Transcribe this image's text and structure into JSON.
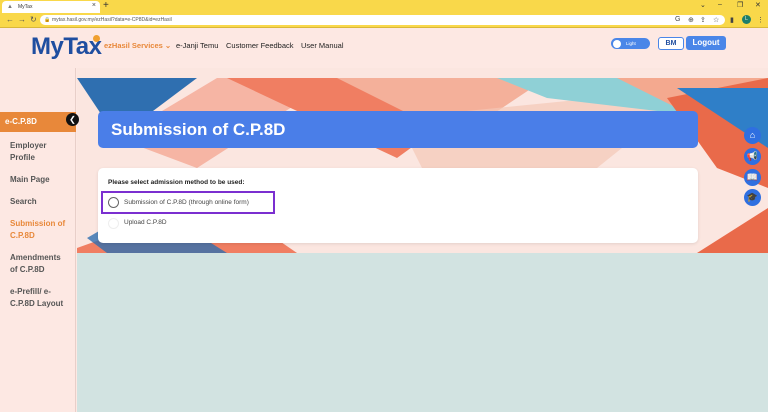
{
  "browser": {
    "tab_title": "MyTax",
    "url": "mytax.hasil.gov.my/ezHasil?data=e-CP8D&id=ezHasil"
  },
  "header": {
    "logo": "MyTax",
    "menu": [
      "ezHasil Services",
      "e-Janji Temu",
      "Customer Feedback",
      "User Manual"
    ],
    "toggle_label": "Light",
    "lang_button": "BM",
    "logout_button": "Logout"
  },
  "sidebar": {
    "title": "e-C.P.8D",
    "items": [
      {
        "label": "Employer Profile"
      },
      {
        "label": "Main Page"
      },
      {
        "label": "Search"
      },
      {
        "label": "Submission of C.P.8D"
      },
      {
        "label": "Amendments of C.P.8D"
      },
      {
        "label": "e-Prefill/ e-C.P.8D Layout"
      }
    ]
  },
  "main": {
    "title": "Submission of C.P.8D",
    "prompt": "Please select admission method to be used:",
    "options": [
      "Submission of C.P.8D (through online form)",
      "Upload C.P.8D"
    ]
  },
  "colors": {
    "brand_blue": "#4a7ee8",
    "accent_orange": "#e8883a",
    "highlight_purple": "#7b2fd0"
  },
  "icons": {
    "fab": [
      "home-icon",
      "megaphone-icon",
      "book-icon",
      "graduation-cap-icon"
    ]
  }
}
